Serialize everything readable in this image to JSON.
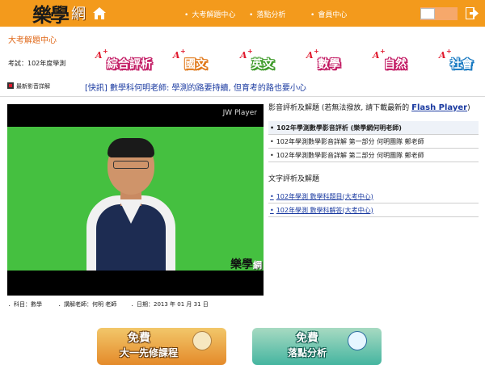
{
  "header": {
    "logo_text": "樂學",
    "logo_text2": "網",
    "nav": [
      {
        "bullet": "•",
        "label": "大考解題中心"
      },
      {
        "bullet": "•",
        "label": "落點分析"
      },
      {
        "bullet": "•",
        "label": "會員中心"
      }
    ],
    "brand_color": "#f39a1c"
  },
  "section_title": "大考解題中心",
  "exam_label": "考試：102年度學測",
  "subjects": [
    {
      "badge": "A",
      "plus": "+",
      "label": "綜合評析"
    },
    {
      "badge": "A",
      "plus": "+",
      "label": "國文"
    },
    {
      "badge": "A",
      "plus": "+",
      "label": "英文"
    },
    {
      "badge": "A",
      "plus": "+",
      "label": "數學"
    },
    {
      "badge": "A",
      "plus": "+",
      "label": "自然"
    },
    {
      "badge": "A",
      "plus": "+",
      "label": "社會"
    }
  ],
  "news": {
    "label": "最新影音詳解",
    "text": "[快訊] 數學科何明老師: 學測的路要持續, 但育考的路也要小心"
  },
  "player": {
    "label": "JW Player",
    "watermark": "樂學",
    "watermark2": "網"
  },
  "meta": {
    "subject": "．科目：數學",
    "teacher": "．講解老師：何明 老師",
    "date": "．日期：2013 年 01 月 31 日"
  },
  "video_section": {
    "heading": "影音評析及解題 (若無法撥放, 請下載最新的",
    "link": "Flash Player",
    "heading_end": ")",
    "items": [
      {
        "bullet": "•",
        "label": "102年學測數學影音評析 (樂學網何明老師)"
      },
      {
        "bullet": "•",
        "label": "102年學測數學影音詳解  第一部分  何明團隊  鄭老師"
      },
      {
        "bullet": "•",
        "label": "102年學測數學影音詳解  第二部分  何明團隊  鄭老師"
      }
    ]
  },
  "text_section": {
    "heading": "文字評析及解題",
    "items": [
      {
        "bullet": "•",
        "label": "102年學測 數學科題目(大考中心)"
      },
      {
        "bullet": "•",
        "label": "102年學測 數學科解答(大考中心)"
      }
    ]
  },
  "banners": [
    {
      "line1": "免費",
      "line2": "大一先修課程"
    },
    {
      "line1": "免費",
      "line2": "落點分析"
    }
  ]
}
